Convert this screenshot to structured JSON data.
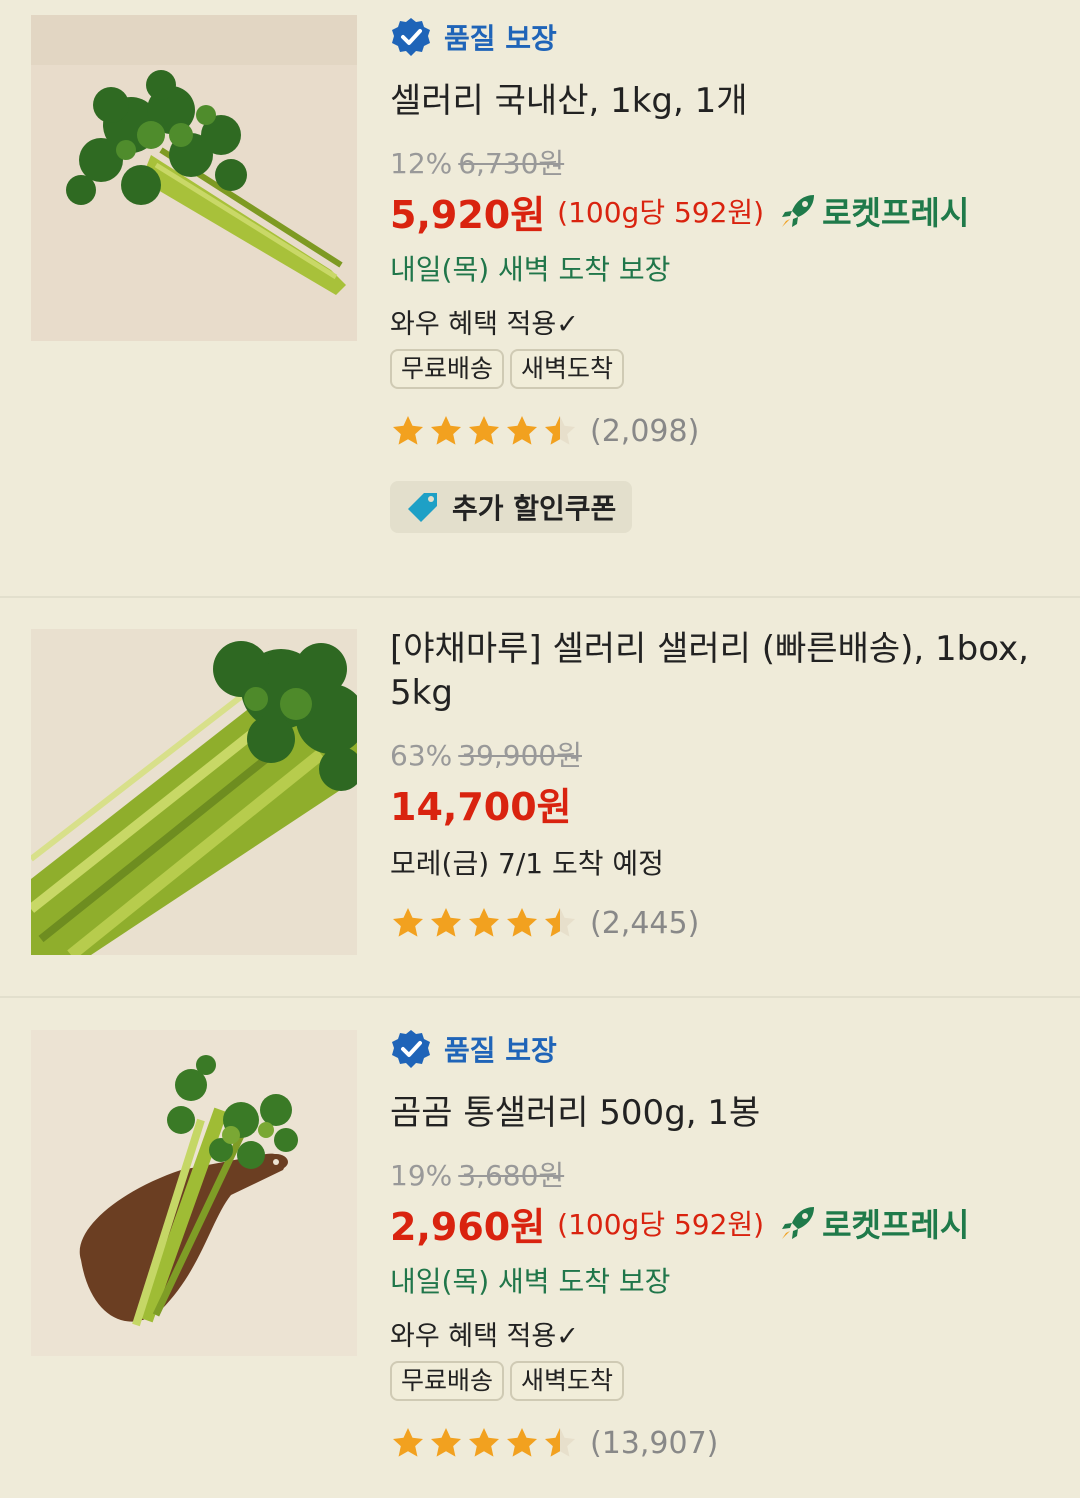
{
  "products": [
    {
      "quality_label": "품질 보장",
      "title": "셀러리 국내산, 1kg, 1개",
      "discount": "12%",
      "original_price": "6,730원",
      "price": "5,920원",
      "unit_price": "(100g당 592원)",
      "rocket_label": "로켓프레시",
      "delivery": "내일(목) 새벽 도착 보장",
      "wow": "와우 혜택 적용✓",
      "tags": [
        "무료배송",
        "새벽도착"
      ],
      "rating": 4.5,
      "review_count": "(2,098)",
      "coupon": "추가 할인쿠폰"
    },
    {
      "title": "[야채마루] 셀러리 샐러리 (빠른배송), 1box, 5kg",
      "discount": "63%",
      "original_price": "39,900원",
      "price": "14,700원",
      "delivery": "모레(금) 7/1 도착 예정",
      "rating": 4.5,
      "review_count": "(2,445)"
    },
    {
      "quality_label": "품질 보장",
      "title": "곰곰 통샐러리 500g, 1봉",
      "discount": "19%",
      "original_price": "3,680원",
      "price": "2,960원",
      "unit_price": "(100g당 592원)",
      "rocket_label": "로켓프레시",
      "delivery": "내일(목) 새벽 도착 보장",
      "wow": "와우 혜택 적용✓",
      "tags": [
        "무료배송",
        "새벽도착"
      ],
      "rating": 4.5,
      "review_count": "(13,907)"
    }
  ],
  "colors": {
    "background": "#efebd9",
    "price_red": "#d9230f",
    "quality_blue": "#1f64b8",
    "rocket_green": "#1f7a4a",
    "star_orange": "#f2a11f"
  }
}
